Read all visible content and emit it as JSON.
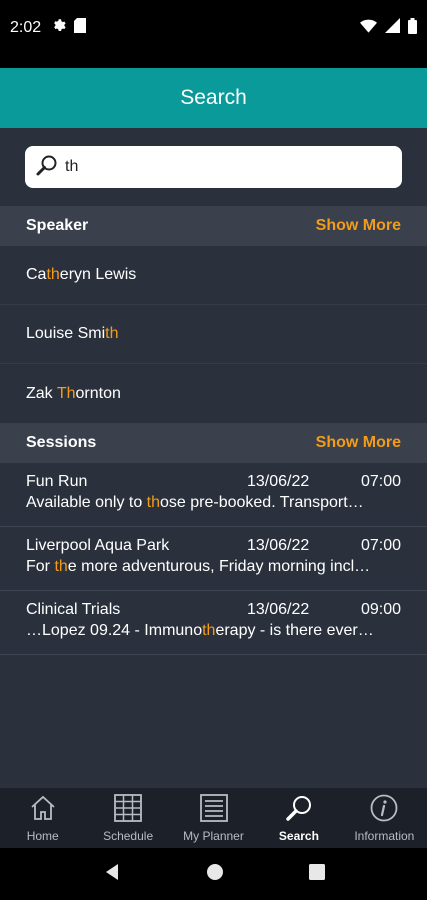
{
  "status": {
    "time": "2:02"
  },
  "header": {
    "title": "Search"
  },
  "search": {
    "value": "th"
  },
  "speakers": {
    "title": "Speaker",
    "more": "Show More",
    "items": [
      {
        "pre": "Ca",
        "hl": "th",
        "post": "eryn Lewis"
      },
      {
        "pre": "Louise Smi",
        "hl": "th",
        "post": ""
      },
      {
        "pre": "Zak ",
        "hl": "Th",
        "post": "ornton"
      }
    ]
  },
  "sessions": {
    "title": "Sessions",
    "more": "Show More",
    "items": [
      {
        "title": "Fun Run",
        "date": "13/06/22",
        "time": "07:00",
        "pre": "Available only to ",
        "hl": "th",
        "post": "ose pre-booked. Transport…"
      },
      {
        "title": "Liverpool Aqua Park",
        "date": "13/06/22",
        "time": "07:00",
        "pre": "For ",
        "hl": "th",
        "post": "e more adventurous, Friday morning incl…"
      },
      {
        "title": "Clinical Trials",
        "date": "13/06/22",
        "time": "09:00",
        "pre": "…Lopez 09.24 - Immuno",
        "hl": "th",
        "post": "erapy - is there ever…"
      }
    ]
  },
  "nav": {
    "home": "Home",
    "schedule": "Schedule",
    "planner": "My Planner",
    "search": "Search",
    "information": "Information"
  },
  "colors": {
    "accent": "#f39c1a",
    "header": "#0a9a9a",
    "background": "#2b313c"
  }
}
